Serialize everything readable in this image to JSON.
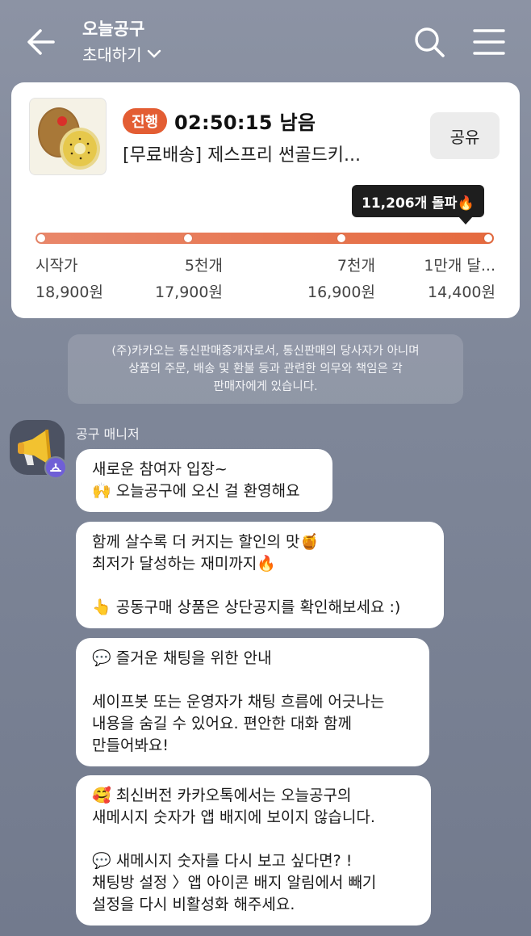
{
  "header": {
    "title": "오늘공구",
    "subtitle": "초대하기"
  },
  "product": {
    "status": "진행",
    "countdown": "02:50:15 남음",
    "name": "[무료배송] 제스프리 썬골드키...",
    "share_label": "공유",
    "milestone_tip": "11,206개 돌파🔥",
    "progress_fraction": 1.0,
    "tiers": [
      {
        "label": "시작가",
        "price": "18,900원"
      },
      {
        "label": "5천개",
        "price": "17,900원"
      },
      {
        "label": "7천개",
        "price": "16,900원"
      },
      {
        "label": "1만개 달...",
        "price": "14,400원"
      }
    ]
  },
  "notice": {
    "lines": [
      "(주)카카오는 통신판매중개자로서, 통신판매의 당사자가 아니며",
      "상품의 주문, 배송 및 환불 등과 관련한 의무와 책임은 각",
      "판매자에게 있습니다."
    ]
  },
  "chat": {
    "sender": "공구 매니저",
    "messages": [
      {
        "lines": [
          "새로운 참여자 입장~",
          "🙌 오늘공구에 오신 걸 환영해요"
        ]
      },
      {
        "lines": [
          "함께 살수록 더 커지는 할인의 맛🍯",
          "최저가 달성하는 재미까지🔥",
          "",
          "👆 공동구매 상품은 상단공지를 확인해보세요 :)"
        ]
      },
      {
        "lines": [
          "💬 즐거운 채팅을 위한 안내",
          "",
          "세이프봇 또는 운영자가 채팅 흐름에 어긋나는",
          "내용을 숨길 수 있어요. 편안한 대화 함께",
          "만들어봐요!"
        ]
      },
      {
        "lines": [
          "🥰 최신버전 카카오톡에서는 오늘공구의",
          "새메시지 숫자가 앱 배지에 보이지 않습니다.",
          "",
          "💬 새메시지 숫자를 다시 보고 싶다면? !",
          "채팅방 설정 〉앱 아이콘 배지 알림에서 빼기",
          "설정을 다시 비활성화 해주세요."
        ]
      }
    ]
  },
  "colors": {
    "accent": "#e35d33",
    "background": "#7f8799"
  }
}
